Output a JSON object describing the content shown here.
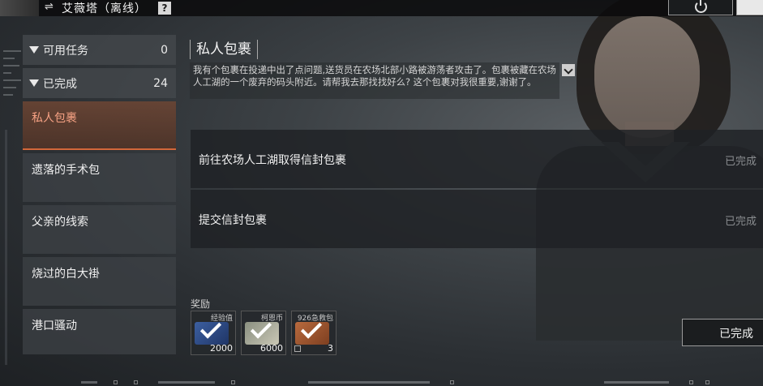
{
  "topbar": {
    "npc_name": "艾薇塔（离线）",
    "swap_icon": "swap-arrows-icon",
    "help_label": "?",
    "power_icon": "power-icon"
  },
  "sidebar": {
    "categories": [
      {
        "label": "可用任务",
        "count": "0"
      },
      {
        "label": "已完成",
        "count": "24"
      }
    ],
    "items": [
      {
        "label": "私人包裹",
        "active": true
      },
      {
        "label": "遗落的手术包"
      },
      {
        "label": "父亲的线索"
      },
      {
        "label": "烧过的白大褂"
      },
      {
        "label": "港口骚动"
      }
    ]
  },
  "quest": {
    "title": "私人包裹",
    "description": "我有个包裹在投递中出了点问题,送货员在农场北部小路被游荡者攻击了。包裹被藏在农场人工湖的一个废弃的码头附近。请帮我去那找找好么? 这个包裹对我很重要,谢谢了。",
    "objectives": [
      {
        "text": "前往农场人工湖取得信封包裹",
        "status": "已完成"
      },
      {
        "text": "提交信封包裹",
        "status": "已完成"
      }
    ]
  },
  "rewards": {
    "label": "奖励",
    "items": [
      {
        "name": "经验值",
        "qty": "2000"
      },
      {
        "name": "柯恩币",
        "qty": "6000"
      },
      {
        "name": "926急救包",
        "qty": "3"
      }
    ]
  },
  "complete_button": "已完成",
  "colors": {
    "accent": "#d2673a",
    "active_text": "#f5a183",
    "status_done": "#8a8d90"
  }
}
